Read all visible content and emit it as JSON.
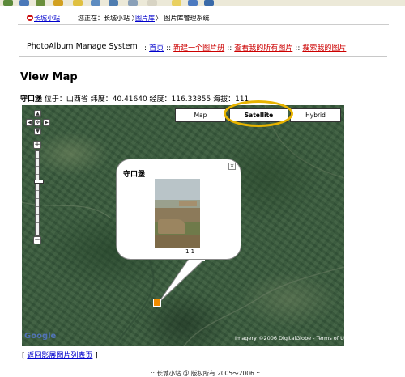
{
  "breadcrumb": {
    "site_link": "长城小站",
    "you_are_at": "您正在：长城小站 〉",
    "gallery_link": "图片库",
    "current": "〉 图片库管理系统"
  },
  "nav": {
    "app_title": "PhotoAlbum Manage System",
    "home": "首页",
    "new_album": "新建一个图片册",
    "my_photos": "查看我的所有图片",
    "search_photos": "搜索我的图片",
    "sep": "::"
  },
  "page": {
    "heading": "View Map",
    "location_name": "守口堡",
    "location_info": "位于：山西省 纬度：40.41640 经度：116.33855 海拔：111"
  },
  "map": {
    "types": [
      "Map",
      "Satellite",
      "Hybrid"
    ],
    "active_type": "Satellite",
    "highlight_color": "#e8b400",
    "marker_color": "#f08c00",
    "pan_icons": [
      "arrow-up-icon",
      "arrow-left-icon",
      "center-icon",
      "arrow-right-icon",
      "arrow-down-icon"
    ],
    "zoom_in": "+",
    "zoom_out": "−",
    "zoom_level_fraction": 0.36,
    "info_window": {
      "title": "守口堡",
      "close": "×",
      "caption": "1.1"
    },
    "attribution": "Imagery ©2006 DigitalGlobe - ",
    "terms": "Terms of Use",
    "google_logo": "Google"
  },
  "back_link": "返回影展图片列表页",
  "footer": ":: 长城小站 ＠ 版权所有  2005～2006 ::"
}
